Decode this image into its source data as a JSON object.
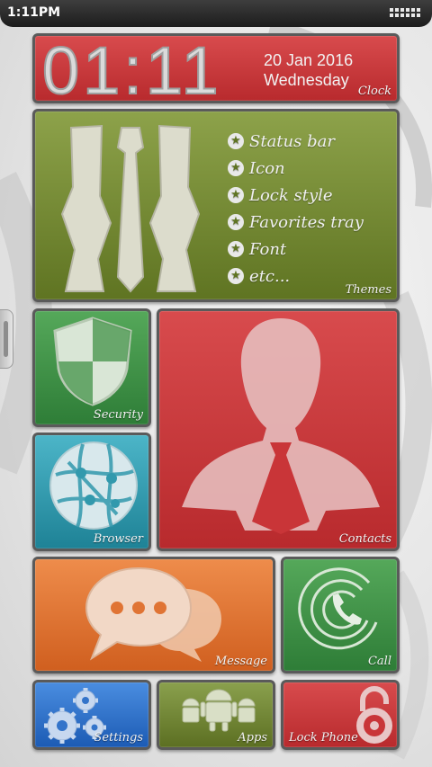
{
  "status_bar": {
    "time": "1:11PM",
    "grid_icon": "app-grid-icon"
  },
  "clock": {
    "time": "01:11",
    "date": "20 Jan 2016",
    "weekday": "Wednesday",
    "label": "Clock"
  },
  "themes": {
    "label": "Themes",
    "items": [
      "Status bar",
      "Icon",
      "Lock style",
      "Favorites tray",
      "Font",
      "etc..."
    ],
    "icon": "suit-tie-icon"
  },
  "tiles": {
    "security": {
      "label": "Security",
      "icon": "shield-icon"
    },
    "browser": {
      "label": "Browser",
      "icon": "globe-network-icon"
    },
    "contacts": {
      "label": "Contacts",
      "icon": "person-silhouette-icon"
    },
    "message": {
      "label": "Message",
      "icon": "chat-bubbles-icon"
    },
    "call": {
      "label": "Call",
      "icon": "phone-icon"
    },
    "settings": {
      "label": "Settings",
      "icon": "gears-icon"
    },
    "apps": {
      "label": "Apps",
      "icon": "android-robots-icon"
    },
    "lock": {
      "label": "Lock Phone",
      "icon": "padlock-icon"
    }
  },
  "colors": {
    "clock_tile": "#c93538",
    "themes_tile": "#7a8f36",
    "security_tile": "#419247",
    "browser_tile": "#3299ad",
    "contacts_tile": "#c93538",
    "message_tile": "#e07434",
    "call_tile": "#419247",
    "settings_tile": "#3374ca",
    "apps_tile": "#7a8f36",
    "lock_tile": "#c93538"
  }
}
